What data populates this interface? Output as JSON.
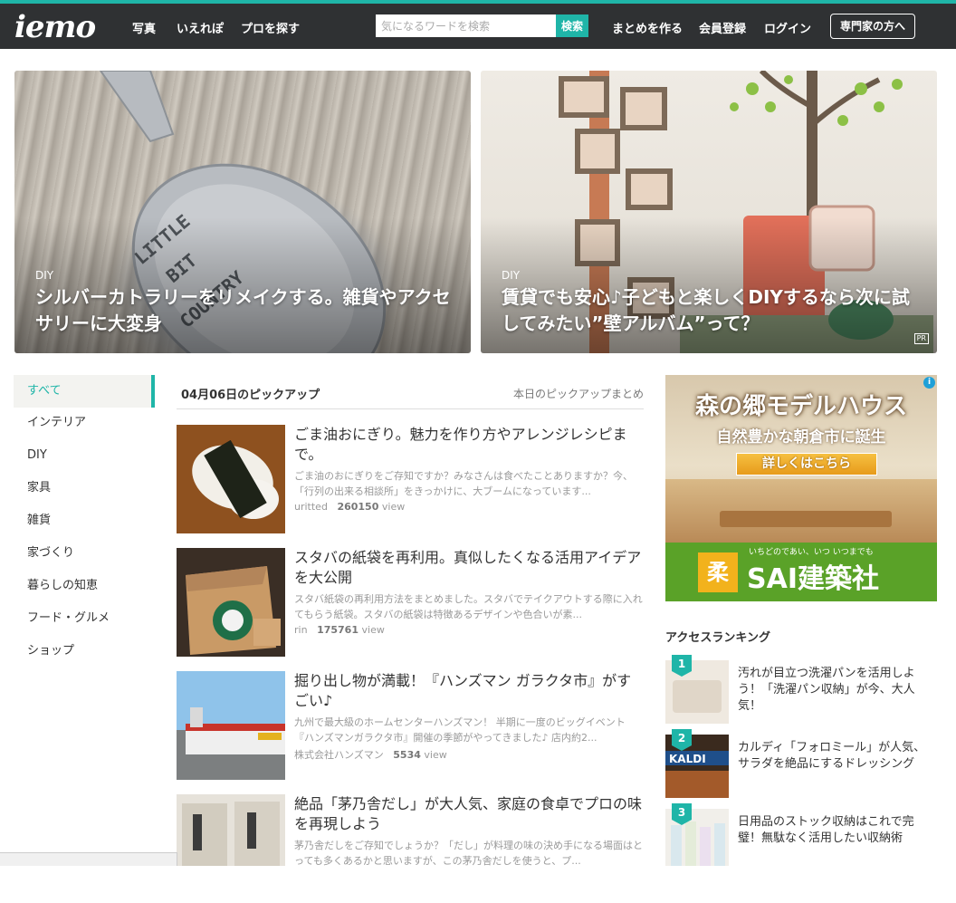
{
  "header": {
    "logo": "iemo",
    "nav": [
      "写真",
      "いえれぽ",
      "プロを探す"
    ],
    "search_placeholder": "気になるワードを検索",
    "search_button": "検索",
    "links": [
      "まとめを作る",
      "会員登録",
      "ログイン"
    ],
    "pro_button": "専門家の方へ"
  },
  "hero": [
    {
      "category": "DIY",
      "title": "シルバーカトラリーをリメイクする。雑貨やアクセサリーに大変身"
    },
    {
      "category": "DIY",
      "title": "賃貸でも安心♪子どもと楽しくDIYするなら次に試してみたい”壁アルバム”って？",
      "pr": "PR"
    }
  ],
  "sidebar": {
    "items": [
      {
        "label": "すべて",
        "active": true
      },
      {
        "label": "インテリア"
      },
      {
        "label": "DIY"
      },
      {
        "label": "家具"
      },
      {
        "label": "雑貨"
      },
      {
        "label": "家づくり"
      },
      {
        "label": "暮らしの知恵"
      },
      {
        "label": "フード・グルメ"
      },
      {
        "label": "ショップ"
      }
    ]
  },
  "pickup": {
    "title": "04月06日のピックアップ",
    "link": "本日のピックアップまとめ",
    "view_suffix": "view",
    "articles": [
      {
        "title": "ごま油おにぎり。魅力を作り方やアレンジレシピまで。",
        "desc": "ごま油のおにぎりをご存知ですか？みなさんは食べたことありますか？今、「行列の出来る相談所」をきっかけに、大ブームになっています...",
        "author": "uritted",
        "views": "260150"
      },
      {
        "title": "スタバの紙袋を再利用。真似したくなる活用アイデアを大公開",
        "desc": "スタバ紙袋の再利用方法をまとめました。スタバでテイクアウトする際に入れてもらう紙袋。スタバの紙袋は特徴あるデザインや色合いが素...",
        "author": "rin",
        "views": "175761"
      },
      {
        "title": "掘り出し物が満載！『ハンズマン ガラクタ市』がすごい♪",
        "desc": "九州で最大級のホームセンターハンズマン！ 半期に一度のビッグイベント『ハンズマンガラクタ市』開催の季節がやってきました♪ 店内約2...",
        "author": "株式会社ハンズマン",
        "views": "5534"
      },
      {
        "title": "絶品「茅乃舎だし」が大人気、家庭の食卓でプロの味を再現しよう",
        "desc": "茅乃舎だしをご存知でしょうか？「だし」が料理の味の決め手になる場面はとっても多くあるかと思いますが、この茅乃舎だしを使うと、プ...",
        "author": "",
        "views": ""
      }
    ]
  },
  "ad": {
    "title": "森の郷モデルハウス",
    "subtitle": "自然豊かな朝倉市に誕生",
    "button": "詳しくはこちら",
    "logo_char": "柔",
    "tagline": "いちどのであい、いつ いつまでも",
    "company": "SAI建築社"
  },
  "ranking": {
    "title": "アクセスランキング",
    "items": [
      {
        "rank": "1",
        "title": "汚れが目立つ洗濯パンを活用しよう！「洗濯パン収納」が今、大人気！"
      },
      {
        "rank": "2",
        "title": "カルディ「フォロミール」が人気、サラダを絶品にするドレッシング"
      },
      {
        "rank": "3",
        "title": "日用品のストック収納はこれで完璧！無駄なく活用したい収納術"
      }
    ]
  },
  "colors": {
    "accent": "#1fb5a8",
    "header_bg": "#2f3133"
  }
}
